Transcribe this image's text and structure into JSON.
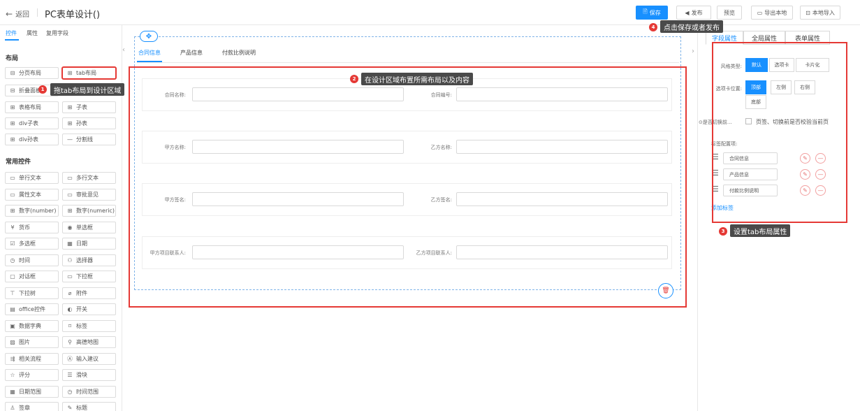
{
  "header": {
    "back_label": "返回",
    "title": "PC表单设计()",
    "buttons": {
      "save": "保存",
      "publish": "发布",
      "preview": "预览",
      "export": "导出本地",
      "import": "本地导入"
    }
  },
  "left_panel": {
    "tabs": [
      "控件",
      "属性",
      "复用字段"
    ],
    "layout_title": "布局",
    "layout_items": [
      {
        "label": "分页布局",
        "icon": "⊟"
      },
      {
        "label": "tab布局",
        "icon": "⊞"
      },
      {
        "label": "折叠面板",
        "icon": "⊟"
      },
      {
        "label": "",
        "icon": ""
      },
      {
        "label": "表格布局",
        "icon": "⊞"
      },
      {
        "label": "子表",
        "icon": "⊞"
      },
      {
        "label": "div子表",
        "icon": "⊞"
      },
      {
        "label": "孙表",
        "icon": "⊞"
      },
      {
        "label": "div孙表",
        "icon": "⊞"
      },
      {
        "label": "分割线",
        "icon": "—"
      }
    ],
    "common_title": "常用控件",
    "common_items": [
      {
        "label": "单行文本",
        "icon": "▭"
      },
      {
        "label": "多行文本",
        "icon": "▭"
      },
      {
        "label": "属性文本",
        "icon": "▭"
      },
      {
        "label": "审批意见",
        "icon": "▭"
      },
      {
        "label": "数字(number)",
        "icon": "⊞"
      },
      {
        "label": "数字(numeric)",
        "icon": "⊞"
      },
      {
        "label": "货币",
        "icon": "¥"
      },
      {
        "label": "单选框",
        "icon": "◉"
      },
      {
        "label": "多选框",
        "icon": "☑"
      },
      {
        "label": "日期",
        "icon": "▦"
      },
      {
        "label": "时间",
        "icon": "◷"
      },
      {
        "label": "选择器",
        "icon": "⚇"
      },
      {
        "label": "对话框",
        "icon": "▢"
      },
      {
        "label": "下拉框",
        "icon": "▭"
      },
      {
        "label": "下拉树",
        "icon": "⊤"
      },
      {
        "label": "附件",
        "icon": "⌀"
      },
      {
        "label": "office控件",
        "icon": "▤"
      },
      {
        "label": "开关",
        "icon": "◐"
      },
      {
        "label": "数据字典",
        "icon": "▣"
      },
      {
        "label": "标签",
        "icon": "⌑"
      },
      {
        "label": "图片",
        "icon": "▨"
      },
      {
        "label": "高德地图",
        "icon": "⚲"
      },
      {
        "label": "相关流程",
        "icon": "⇶"
      },
      {
        "label": "输入建议",
        "icon": "Ⓐ"
      },
      {
        "label": "评分",
        "icon": "☆"
      },
      {
        "label": "滑块",
        "icon": "☰"
      },
      {
        "label": "日期范围",
        "icon": "▦"
      },
      {
        "label": "时间范围",
        "icon": "◷"
      },
      {
        "label": "签章",
        "icon": "♙"
      },
      {
        "label": "标题",
        "icon": "✎"
      }
    ]
  },
  "annotations": {
    "step1": {
      "num": "1",
      "text": "拖tab布局到设计区域"
    },
    "step2": {
      "num": "2",
      "text": "在设计区域布置所需布局以及内容"
    },
    "step3": {
      "num": "3",
      "text": "设置tab布局属性"
    },
    "step4": {
      "num": "4",
      "text": "点击保存或者发布"
    }
  },
  "design": {
    "tabs": [
      "合同信息",
      "产品信息",
      "付款比例说明"
    ],
    "rows": [
      {
        "left": "合同名称:",
        "right": "合同编号:"
      },
      {
        "left": "甲方名称:",
        "right": "乙方名称:"
      },
      {
        "left": "甲方签名:",
        "right": "乙方签名:"
      },
      {
        "left": "甲方项目联系人:",
        "right": "乙方项目联系人:"
      }
    ]
  },
  "right_panel": {
    "tabs": [
      "字段属性",
      "全局属性",
      "表单属性"
    ],
    "style_label": "风格类型:",
    "style_options": [
      "默认",
      "选项卡",
      "卡片化"
    ],
    "position_label": "选项卡位置:",
    "position_options": [
      "顶部",
      "左侧",
      "右侧",
      "底部"
    ],
    "switch_label": "⊙是否切换前...",
    "switch_text": "页签、切换前是否校验当前页",
    "config_label": "标签配置项:",
    "tab_items": [
      "合同信息",
      "产品信息",
      "付款比例说明"
    ],
    "add_label": "添加标签"
  },
  "colors": {
    "primary": "#1890ff",
    "highlight": "#e53935",
    "tooltip_bg": "#4a4a4a"
  }
}
